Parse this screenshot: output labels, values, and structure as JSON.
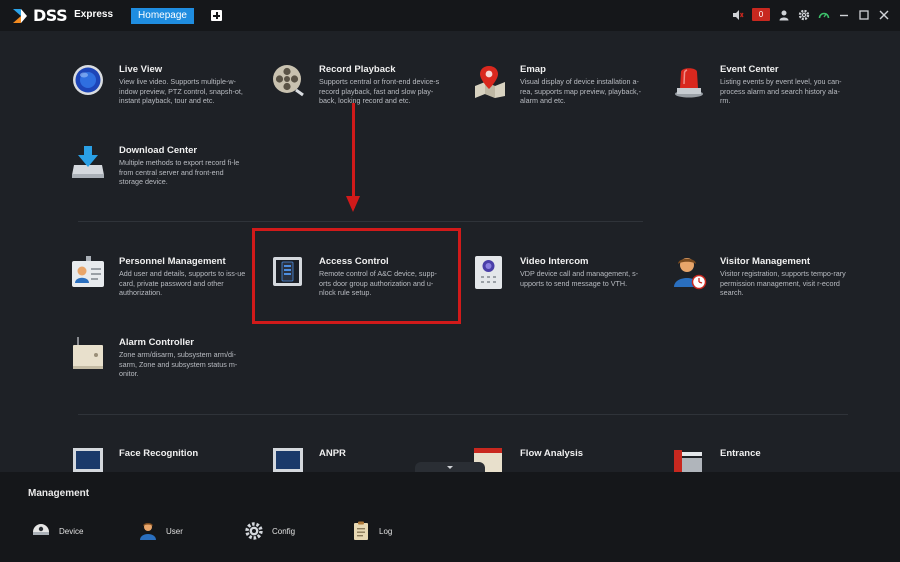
{
  "app": {
    "logo_main": "DSS",
    "logo_sub": "Express"
  },
  "tabs": {
    "home": "Homepage"
  },
  "toolbar": {
    "alarm_count": "0"
  },
  "modules": [
    {
      "title": "Live View",
      "desc": "View live video. Supports multiple-w-indow preview, PTZ control, snapsh-ot, instant playback, tour and etc."
    },
    {
      "title": "Record Playback",
      "desc": "Supports central or front-end device-s record playback, fast and slow play-back, locking record and etc."
    },
    {
      "title": "Emap",
      "desc": "Visual display of device installation a-rea, supports map preview, playback,-alarm and etc."
    },
    {
      "title": "Event Center",
      "desc": "Listing events by event level, you can-process alarm and search history ala-rm."
    },
    {
      "title": "Download Center",
      "desc": "Multiple methods to export record fi-le from central server and front-end storage device."
    },
    {
      "title": "Personnel Management",
      "desc": "Add user and details, supports to iss-ue card, private password and other authorization."
    },
    {
      "title": "Access Control",
      "desc": "Remote control of A&C device, supp-orts door group authorization and u-nlock rule setup."
    },
    {
      "title": "Video Intercom",
      "desc": "VDP device call and management, s-upports to send message to VTH."
    },
    {
      "title": "Visitor Management",
      "desc": "Visitor registration, supports tempo-rary permission management, visit r-ecord search."
    },
    {
      "title": "Alarm Controller",
      "desc": "Zone arm/disarm, subsystem arm/di-sarm, Zone and subsystem status m-onitor."
    },
    {
      "title": "Face Recognition",
      "desc": ""
    },
    {
      "title": "ANPR",
      "desc": ""
    },
    {
      "title": "Flow Analysis",
      "desc": ""
    },
    {
      "title": "Entrance",
      "desc": ""
    }
  ],
  "management": {
    "title": "Management",
    "items": [
      {
        "label": "Device"
      },
      {
        "label": "User"
      },
      {
        "label": "Config"
      },
      {
        "label": "Log"
      }
    ]
  },
  "colors": {
    "accent": "#1f8de0",
    "highlight": "#d11a1a",
    "background": "#1e2126"
  }
}
